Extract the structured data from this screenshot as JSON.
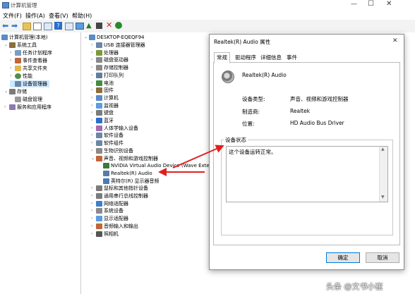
{
  "window": {
    "title": "计算机管理"
  },
  "menu": [
    "文件(F)",
    "操作(A)",
    "查看(V)",
    "帮助(H)"
  ],
  "left_tree": {
    "root": "计算机管理(本地)",
    "items": [
      {
        "label": "系统工具",
        "level": 1
      },
      {
        "label": "任务计划程序",
        "level": 2
      },
      {
        "label": "事件查看器",
        "level": 2
      },
      {
        "label": "共享文件夹",
        "level": 2
      },
      {
        "label": "性能",
        "level": 2
      },
      {
        "label": "设备管理器",
        "level": 2,
        "selected": true
      },
      {
        "label": "存储",
        "level": 1
      },
      {
        "label": "磁盘管理",
        "level": 2
      },
      {
        "label": "服务和应用程序",
        "level": 1
      }
    ]
  },
  "device_tree": {
    "root": "DESKTOP-EQEQF94",
    "items": [
      {
        "label": "USB 连接器管理器",
        "level": 1
      },
      {
        "label": "处理器",
        "level": 1
      },
      {
        "label": "磁盘驱动器",
        "level": 1
      },
      {
        "label": "存储控制器",
        "level": 1
      },
      {
        "label": "打印队列",
        "level": 1
      },
      {
        "label": "电池",
        "level": 1
      },
      {
        "label": "固件",
        "level": 1
      },
      {
        "label": "计算机",
        "level": 1
      },
      {
        "label": "监视器",
        "level": 1
      },
      {
        "label": "键盘",
        "level": 1
      },
      {
        "label": "蓝牙",
        "level": 1
      },
      {
        "label": "人体学输入设备",
        "level": 1
      },
      {
        "label": "软件设备",
        "level": 1
      },
      {
        "label": "软件组件",
        "level": 1
      },
      {
        "label": "生物识别设备",
        "level": 1
      },
      {
        "label": "声音、视频和游戏控制器",
        "level": 1,
        "expanded": true
      },
      {
        "label": "NVIDIA Virtual Audio Device (Wave Exte",
        "level": 2
      },
      {
        "label": "Realtek(R) Audio",
        "level": 2
      },
      {
        "label": "英特尔(R) 显示器音频",
        "level": 2
      },
      {
        "label": "鼠标和其他指针设备",
        "level": 1
      },
      {
        "label": "通用串行总线控制器",
        "level": 1
      },
      {
        "label": "网络适配器",
        "level": 1
      },
      {
        "label": "系统设备",
        "level": 1
      },
      {
        "label": "显示适配器",
        "level": 1
      },
      {
        "label": "音频输入和输出",
        "level": 1
      },
      {
        "label": "照相机",
        "level": 1
      }
    ]
  },
  "dialog": {
    "title": "Realtek(R) Audio 属性",
    "tabs": [
      "常规",
      "驱动程序",
      "详细信息",
      "事件"
    ],
    "device_name": "Realtek(R) Audio",
    "props": [
      {
        "label": "设备类型:",
        "value": "声音、视频和游戏控制器"
      },
      {
        "label": "制造商:",
        "value": "Realtek"
      },
      {
        "label": "位置:",
        "value": "HD Audio Bus Driver"
      }
    ],
    "status_group_label": "设备状态",
    "status_text": "这个设备运转正常。",
    "ok_label": "确定",
    "cancel_label": "取消"
  },
  "watermark": "头条 @文书小崔",
  "colors": {
    "arrow": "#e02020",
    "selection": "#cce8ff",
    "accent": "#0078d7"
  }
}
